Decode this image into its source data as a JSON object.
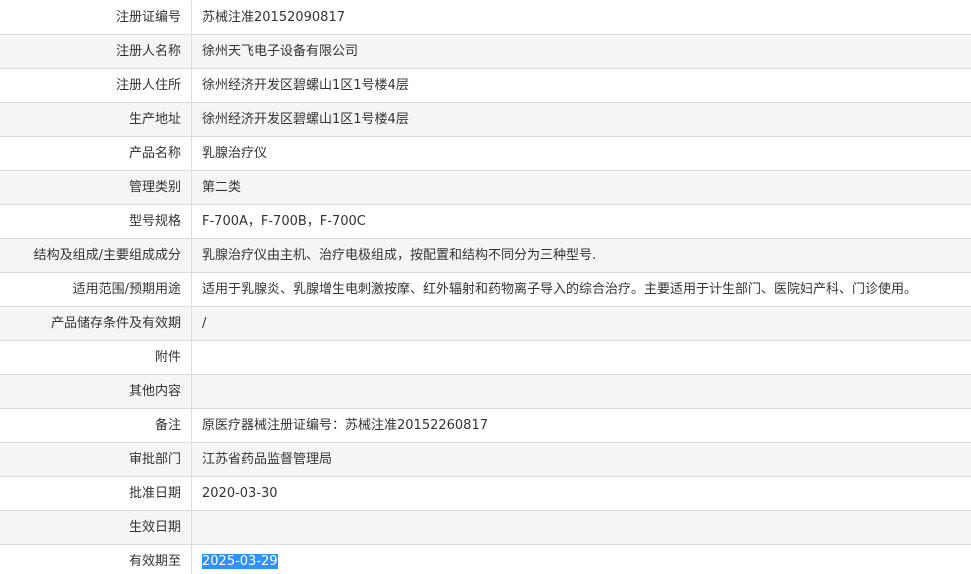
{
  "record": {
    "rows": [
      {
        "label": "注册证编号",
        "value": "苏械注准20152090817"
      },
      {
        "label": "注册人名称",
        "value": "徐州天飞电子设备有限公司"
      },
      {
        "label": "注册人住所",
        "value": "徐州经济开发区碧螺山1区1号楼4层"
      },
      {
        "label": "生产地址",
        "value": "徐州经济开发区碧螺山1区1号楼4层"
      },
      {
        "label": "产品名称",
        "value": "乳腺治疗仪"
      },
      {
        "label": "管理类别",
        "value": "第二类"
      },
      {
        "label": "型号规格",
        "value": "F-700A，F-700B，F-700C"
      },
      {
        "label": "结构及组成/主要组成成分",
        "value": "乳腺治疗仪由主机、治疗电极组成，按配置和结构不同分为三种型号."
      },
      {
        "label": "适用范围/预期用途",
        "value": "适用于乳腺炎、乳腺增生电刺激按摩、红外辐射和药物离子导入的综合治疗。主要适用于计生部门、医院妇产科、门诊使用。"
      },
      {
        "label": "产品储存条件及有效期",
        "value": "/"
      },
      {
        "label": "附件",
        "value": ""
      },
      {
        "label": "其他内容",
        "value": ""
      },
      {
        "label": "备注",
        "value": "原医疗器械注册证编号：苏械注准20152260817"
      },
      {
        "label": "审批部门",
        "value": "江苏省药品监督管理局"
      },
      {
        "label": "批准日期",
        "value": "2020-03-30"
      },
      {
        "label": "生效日期",
        "value": ""
      },
      {
        "label": "有效期至",
        "value": "2025-03-29"
      }
    ]
  }
}
